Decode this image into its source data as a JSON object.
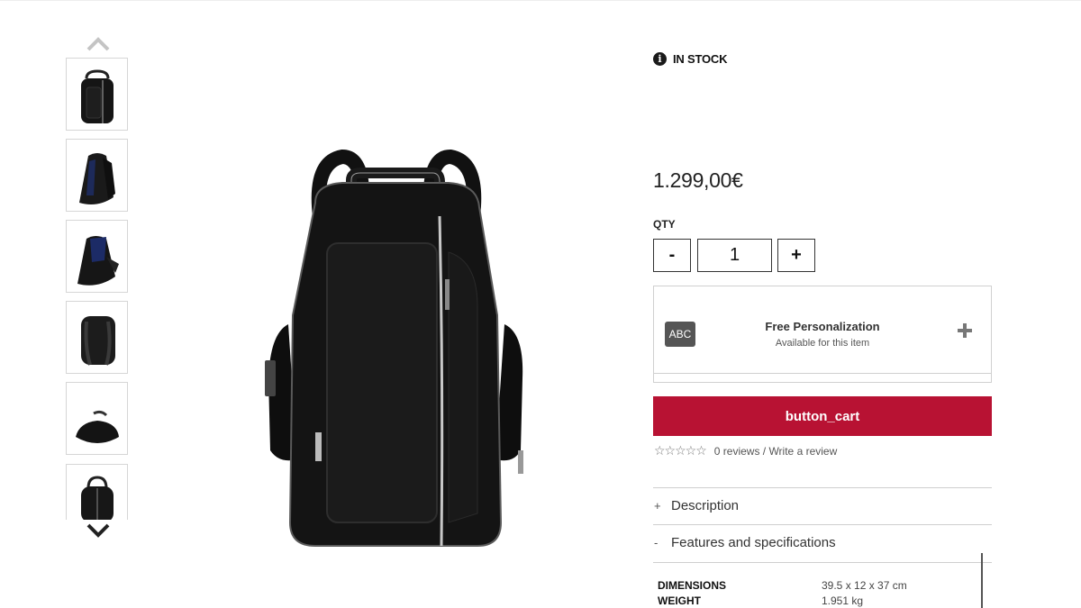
{
  "gallery": {
    "thumbnails": [
      {
        "view": "front"
      },
      {
        "view": "side-open"
      },
      {
        "view": "side-pocket"
      },
      {
        "view": "back"
      },
      {
        "view": "bottom"
      },
      {
        "view": "top"
      }
    ]
  },
  "product": {
    "stock_status": "IN STOCK",
    "price": "1.299,00€",
    "qty_label": "QTY",
    "qty_minus": "-",
    "qty_plus": "+",
    "qty_value": "1"
  },
  "personalization": {
    "badge": "ABC",
    "title": "Free Personalization",
    "subtitle": "Available for this item"
  },
  "cart": {
    "button_label": "button_cart"
  },
  "reviews": {
    "stars": "☆☆☆☆☆",
    "text": "0 reviews / Write a review"
  },
  "accordion": {
    "description": {
      "sign": "+",
      "label": "Description"
    },
    "features": {
      "sign": "-",
      "label": "Features and specifications"
    }
  },
  "specs": [
    {
      "key": "DIMENSIONS",
      "value": "39.5 x 12 x 37 cm"
    },
    {
      "key": "WEIGHT",
      "value": "1.951 kg"
    }
  ],
  "colors": {
    "accent": "#b81233",
    "badge": "#555555",
    "border": "#d0d0d0"
  }
}
